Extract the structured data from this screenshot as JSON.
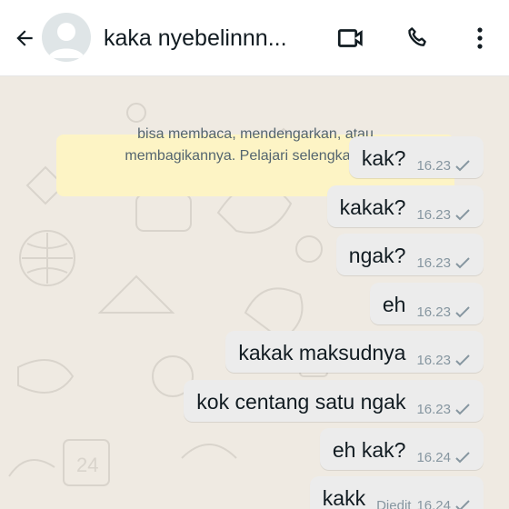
{
  "header": {
    "contact_name": "kaka nyebelinnn..."
  },
  "notice": {
    "line1": "bisa membaca, mendengarkan, atau",
    "line2": "membagikannya. Pelajari selengkapnya."
  },
  "messages": [
    {
      "text": "kak?",
      "time": "16.23",
      "status": ""
    },
    {
      "text": "kakak?",
      "time": "16.23",
      "status": ""
    },
    {
      "text": "ngak?",
      "time": "16.23",
      "status": ""
    },
    {
      "text": "eh",
      "time": "16.23",
      "status": ""
    },
    {
      "text": "kakak maksudnya",
      "time": "16.23",
      "status": ""
    },
    {
      "text": "kok centang satu ngak",
      "time": "16.23",
      "status": ""
    },
    {
      "text": "eh kak?",
      "time": "16.24",
      "status": ""
    },
    {
      "text": "kakk",
      "time": "16.24",
      "status": "Diedit"
    }
  ],
  "colors": {
    "header_bg": "#ffffff",
    "chat_bg": "#efeae2",
    "bubble_bg": "#ececec",
    "notice_bg": "#fdf4c5",
    "meta_text": "#8696a0"
  },
  "icons": {
    "back": "arrow-left-icon",
    "video": "videocam-icon",
    "call": "phone-icon",
    "menu": "more-vert-icon",
    "tick": "single-check-icon"
  }
}
